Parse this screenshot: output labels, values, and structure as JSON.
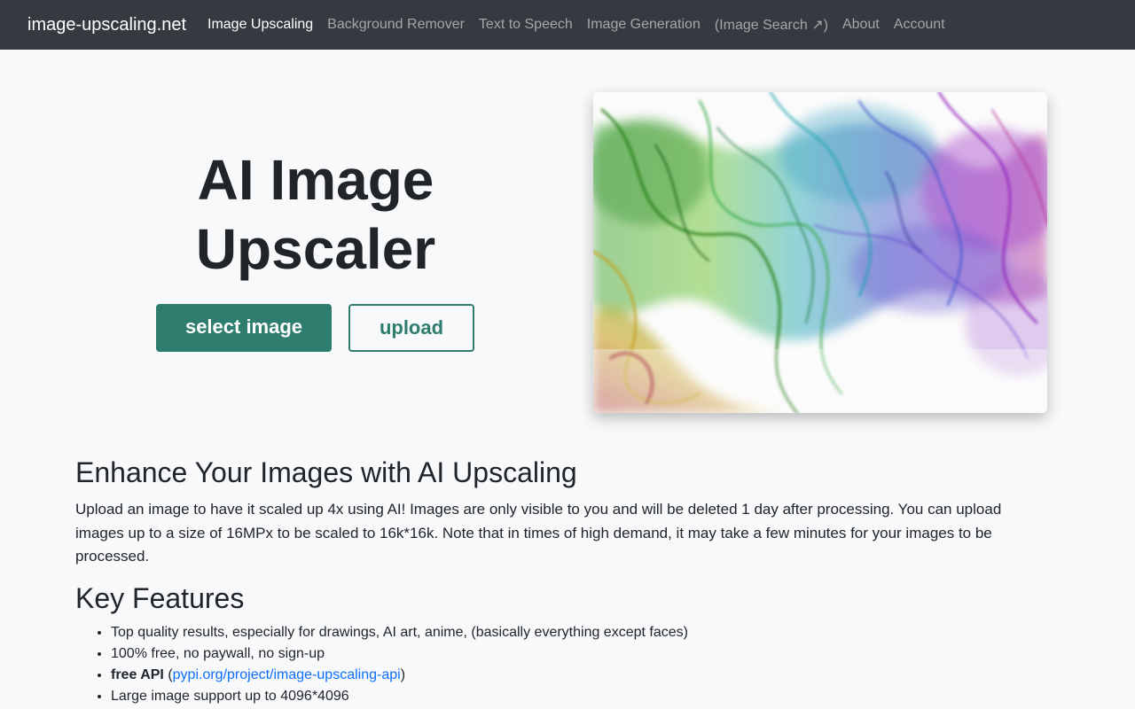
{
  "nav": {
    "brand": "image-upscaling.net",
    "items": [
      {
        "label": "Image Upscaling",
        "active": true
      },
      {
        "label": "Background Remover",
        "active": false
      },
      {
        "label": "Text to Speech",
        "active": false
      },
      {
        "label": "Image Generation",
        "active": false
      },
      {
        "label": "(Image Search ↗)",
        "active": false
      },
      {
        "label": "About",
        "active": false
      },
      {
        "label": "Account",
        "active": false
      }
    ]
  },
  "hero": {
    "title_line1": "AI Image",
    "title_line2": "Upscaler",
    "select_button": "select image",
    "upload_button": "upload"
  },
  "content": {
    "section_title": "Enhance Your Images with AI Upscaling",
    "intro": "Upload an image to have it scaled up 4x using AI! Images are only visible to you and will be deleted 1 day after processing. You can upload images up to a size of 16MPx to be scaled to 16k*16k. Note that in times of high demand, it may take a few minutes for your images to be processed.",
    "features_title": "Key Features",
    "features": {
      "f1": "Top quality results, especially for drawings, AI art, anime, (basically everything except faces)",
      "f2": "100% free, no paywall, no sign-up",
      "f3_bold": "free API",
      "f3_open": " (",
      "f3_link": "pypi.org/project/image-upscaling-api",
      "f3_close": ")",
      "f4": "Large image support up to 4096*4096"
    }
  },
  "colors": {
    "navbar": "#343a40",
    "accent": "#2e7d6e",
    "link": "#0d6efd",
    "background": "#f8f9fa"
  }
}
